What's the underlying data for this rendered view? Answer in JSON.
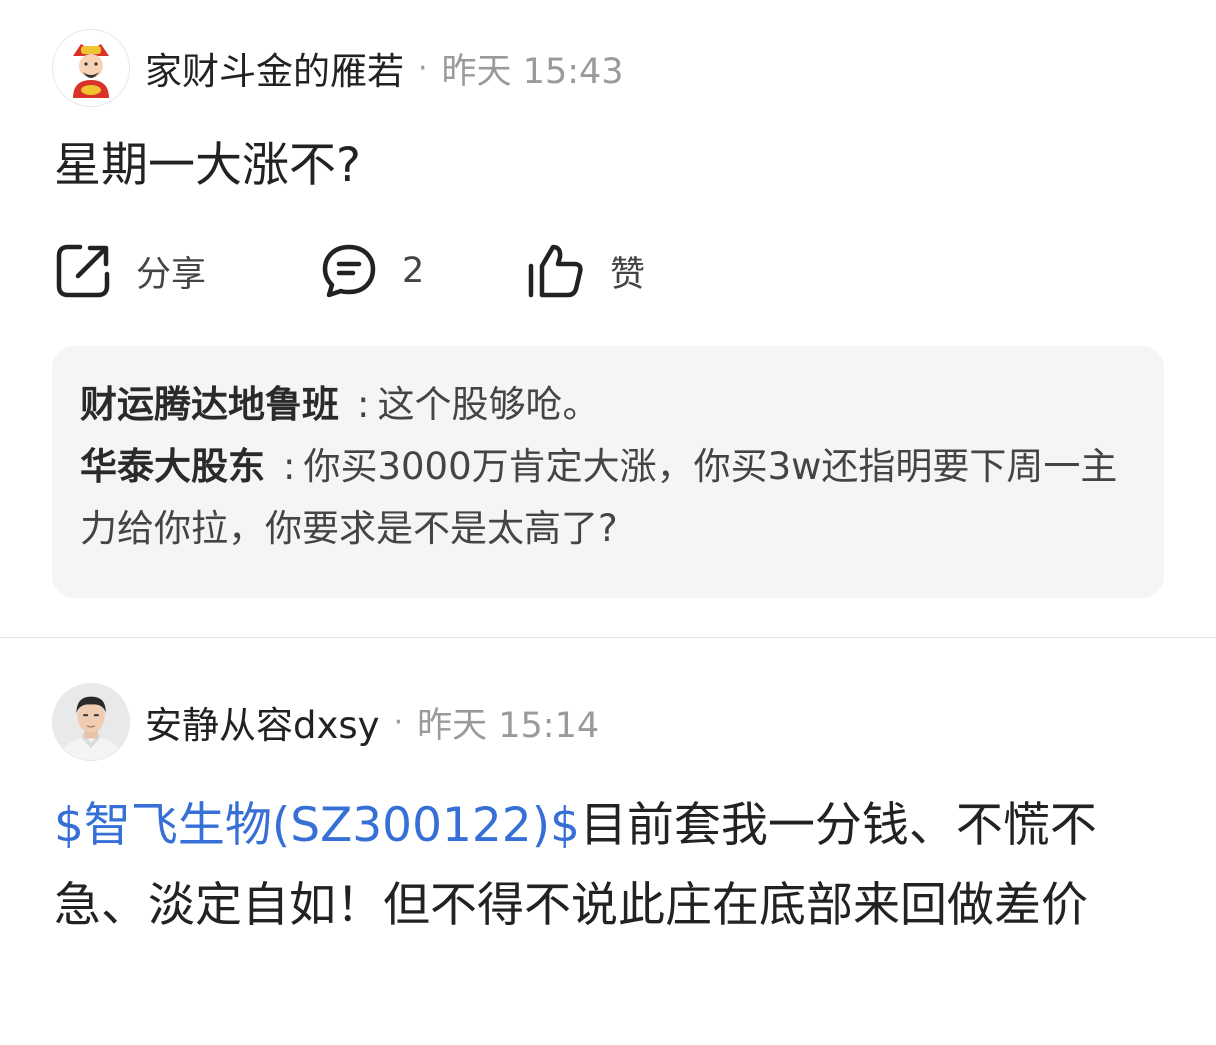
{
  "posts": [
    {
      "author": "家财斗金的雁若",
      "separator": "·",
      "time": "昨天 15:43",
      "avatar_icon": "god-of-wealth-avatar",
      "content": "星期一大涨不?",
      "actions": {
        "share_label": "分享",
        "comment_count": "2",
        "like_label": "赞"
      },
      "replies": [
        {
          "user": "财运腾达地鲁班",
          "separator": ":",
          "text": "这个股够呛。"
        },
        {
          "user": "华泰大股东",
          "separator": ":",
          "text": "你买3000万肯定大涨，你买3w还指明要下周一主力给你拉，你要求是不是太高了?"
        }
      ]
    },
    {
      "author": "安静从容dxsy",
      "separator": "·",
      "time": "昨天 15:14",
      "avatar_icon": "user-photo-avatar",
      "stock_link": "$智飞生物(SZ300122)$",
      "content": "目前套我一分钱、不慌不急、淡定自如！但不得不说此庄在底部来回做差价"
    }
  ],
  "colors": {
    "link": "#3670d6",
    "muted": "#9a9a9a",
    "reply_bg": "#f5f5f7",
    "text": "#222222"
  }
}
